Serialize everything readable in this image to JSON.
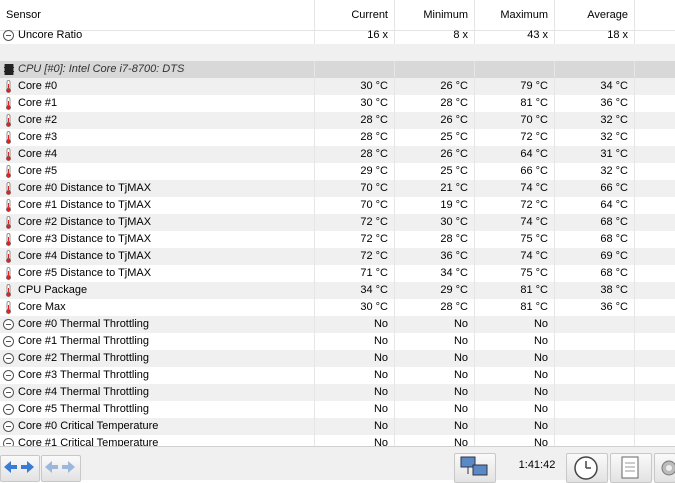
{
  "columns": {
    "sensor": "Sensor",
    "current": "Current",
    "minimum": "Minimum",
    "maximum": "Maximum",
    "average": "Average"
  },
  "uncore": {
    "label": "Uncore Ratio",
    "current": "16 x",
    "minimum": "8 x",
    "maximum": "43 x",
    "average": "18 x"
  },
  "group_title": "CPU [#0]: Intel Core i7-8700: DTS",
  "temps": [
    {
      "label": "Core #0",
      "current": "30 °C",
      "minimum": "26 °C",
      "maximum": "79 °C",
      "average": "34 °C"
    },
    {
      "label": "Core #1",
      "current": "30 °C",
      "minimum": "28 °C",
      "maximum": "81 °C",
      "average": "36 °C"
    },
    {
      "label": "Core #2",
      "current": "28 °C",
      "minimum": "26 °C",
      "maximum": "70 °C",
      "average": "32 °C"
    },
    {
      "label": "Core #3",
      "current": "28 °C",
      "minimum": "25 °C",
      "maximum": "72 °C",
      "average": "32 °C"
    },
    {
      "label": "Core #4",
      "current": "28 °C",
      "minimum": "26 °C",
      "maximum": "64 °C",
      "average": "31 °C"
    },
    {
      "label": "Core #5",
      "current": "29 °C",
      "minimum": "25 °C",
      "maximum": "66 °C",
      "average": "32 °C"
    },
    {
      "label": "Core #0 Distance to TjMAX",
      "current": "70 °C",
      "minimum": "21 °C",
      "maximum": "74 °C",
      "average": "66 °C"
    },
    {
      "label": "Core #1 Distance to TjMAX",
      "current": "70 °C",
      "minimum": "19 °C",
      "maximum": "72 °C",
      "average": "64 °C"
    },
    {
      "label": "Core #2 Distance to TjMAX",
      "current": "72 °C",
      "minimum": "30 °C",
      "maximum": "74 °C",
      "average": "68 °C"
    },
    {
      "label": "Core #3 Distance to TjMAX",
      "current": "72 °C",
      "minimum": "28 °C",
      "maximum": "75 °C",
      "average": "68 °C"
    },
    {
      "label": "Core #4 Distance to TjMAX",
      "current": "72 °C",
      "minimum": "36 °C",
      "maximum": "74 °C",
      "average": "69 °C"
    },
    {
      "label": "Core #5 Distance to TjMAX",
      "current": "71 °C",
      "minimum": "34 °C",
      "maximum": "75 °C",
      "average": "68 °C"
    },
    {
      "label": "CPU Package",
      "current": "34 °C",
      "minimum": "29 °C",
      "maximum": "81 °C",
      "average": "38 °C"
    },
    {
      "label": "Core Max",
      "current": "30 °C",
      "minimum": "28 °C",
      "maximum": "81 °C",
      "average": "36 °C"
    }
  ],
  "flags": [
    {
      "label": "Core #0 Thermal Throttling",
      "current": "No",
      "minimum": "No",
      "maximum": "No"
    },
    {
      "label": "Core #1 Thermal Throttling",
      "current": "No",
      "minimum": "No",
      "maximum": "No"
    },
    {
      "label": "Core #2 Thermal Throttling",
      "current": "No",
      "minimum": "No",
      "maximum": "No"
    },
    {
      "label": "Core #3 Thermal Throttling",
      "current": "No",
      "minimum": "No",
      "maximum": "No"
    },
    {
      "label": "Core #4 Thermal Throttling",
      "current": "No",
      "minimum": "No",
      "maximum": "No"
    },
    {
      "label": "Core #5 Thermal Throttling",
      "current": "No",
      "minimum": "No",
      "maximum": "No"
    },
    {
      "label": "Core #0 Critical Temperature",
      "current": "No",
      "minimum": "No",
      "maximum": "No"
    },
    {
      "label": "Core #1 Critical Temperature",
      "current": "No",
      "minimum": "No",
      "maximum": "No"
    }
  ],
  "status": {
    "elapsed": "1:41:42"
  },
  "icons": {
    "nav_left": "arrow-left-right-icon",
    "nav_right": "arrow-left-right-icon-disabled",
    "network": "network-icon",
    "clock": "clock-icon",
    "report": "report-icon",
    "settings": "gear-icon"
  },
  "colors": {
    "thermo_red": "#d22",
    "row_alt": "#f0f0f0",
    "group_bg": "#d8d8d8"
  }
}
